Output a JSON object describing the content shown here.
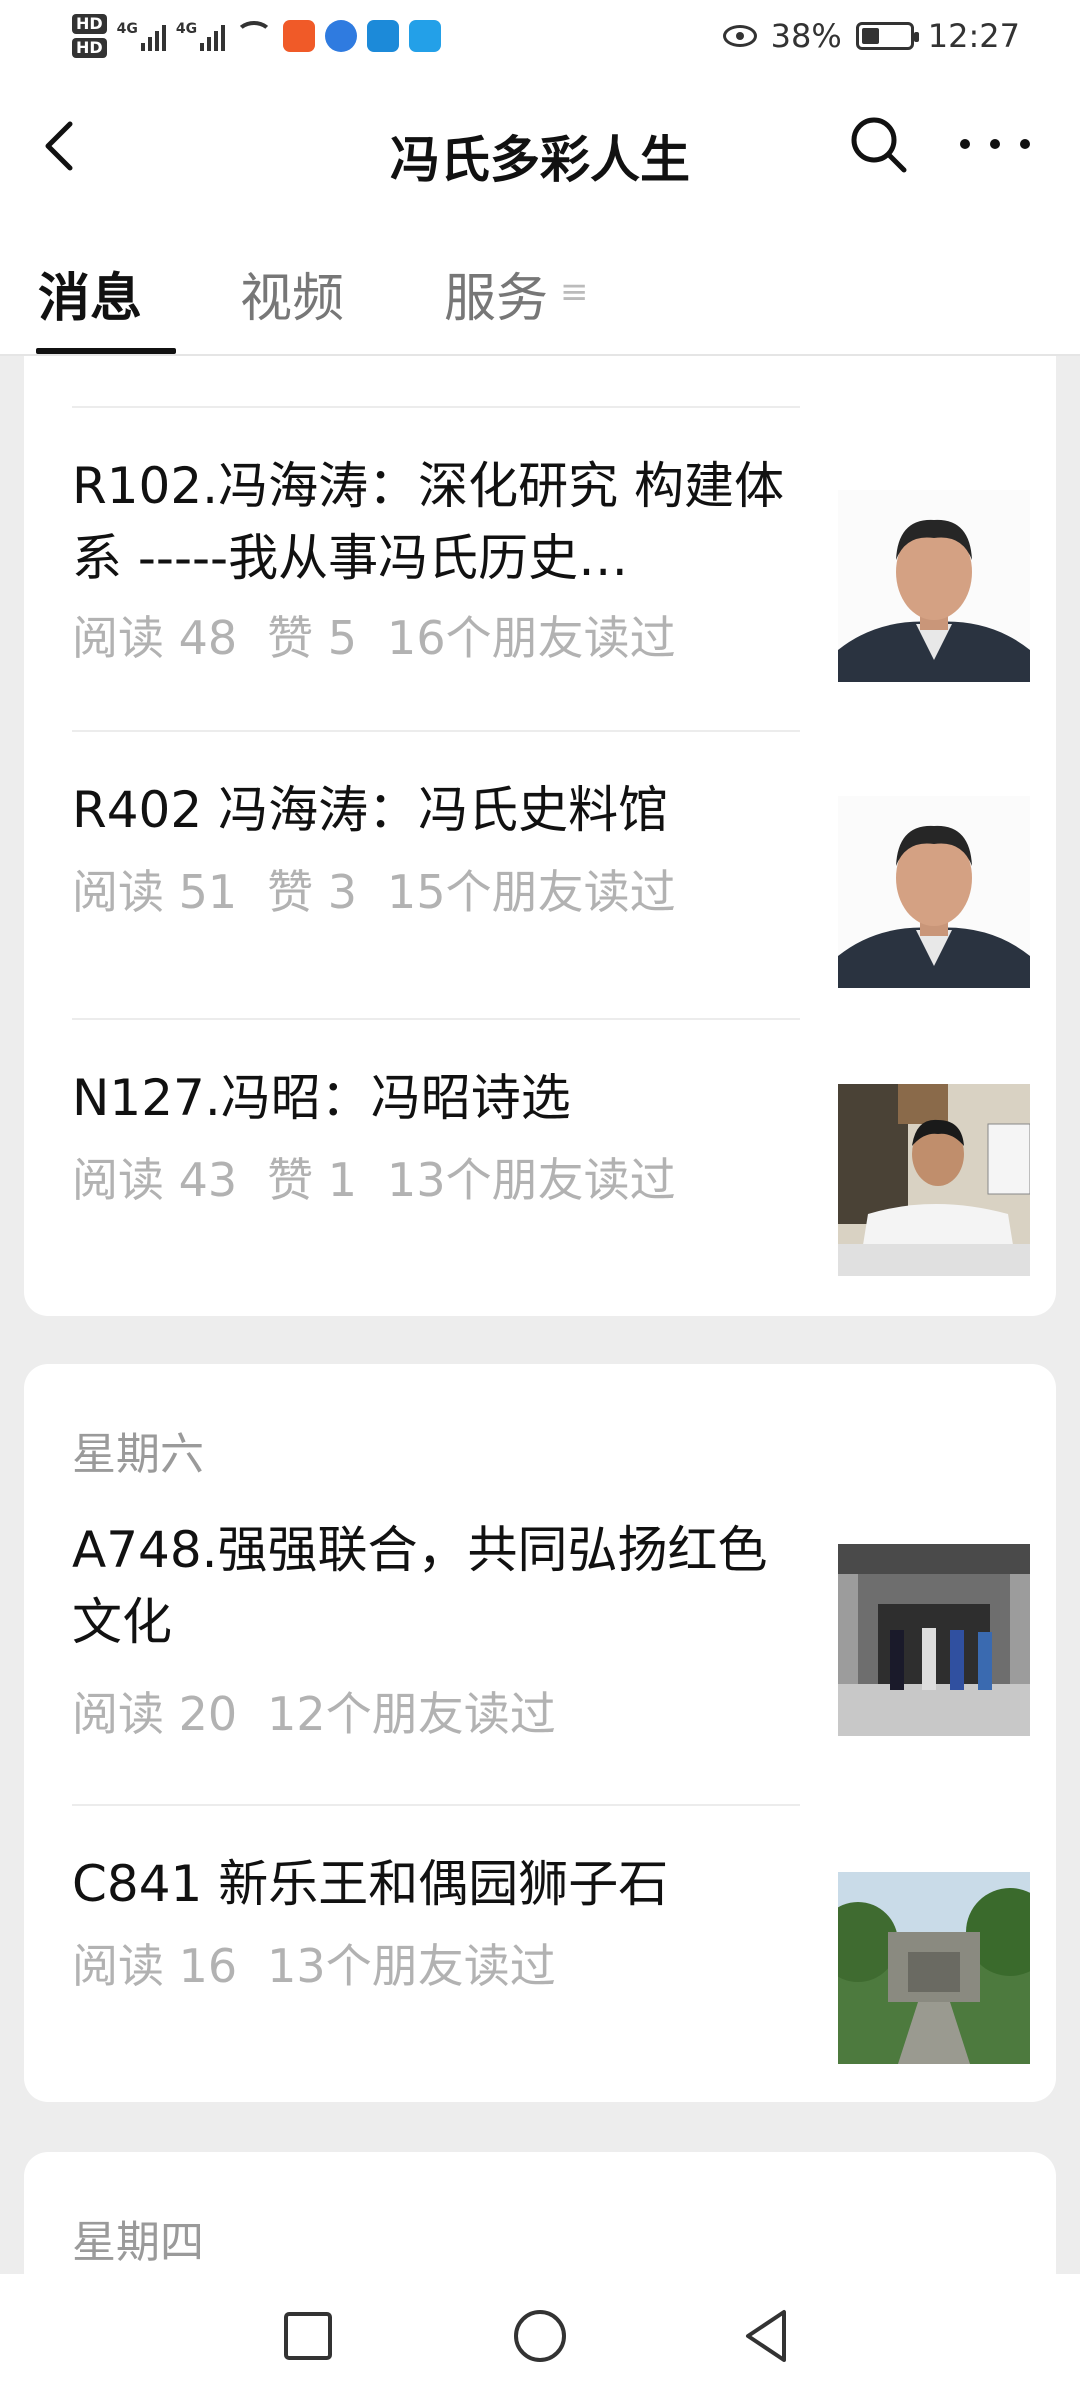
{
  "status_bar": {
    "hd1": "HD",
    "hd2": "HD",
    "net1": "4G",
    "net2": "4G",
    "battery_percent": "38%",
    "battery_level": 0.38,
    "time": "12:27"
  },
  "navbar": {
    "title": "冯氏多彩人生"
  },
  "tabs": {
    "items": [
      {
        "label": "消息"
      },
      {
        "label": "视频"
      },
      {
        "label": "服务"
      }
    ],
    "menu_glyph": "≡"
  },
  "articles": [
    {
      "title": "R102.冯海涛：深化研究 构建体系 -----我从事冯氏历史…",
      "reads": "阅读 48",
      "likes": "赞 5",
      "friends": "16个朋友读过"
    },
    {
      "title": "R402 冯海涛：冯氏史料馆",
      "reads": "阅读 51",
      "likes": "赞 3",
      "friends": "15个朋友读过"
    },
    {
      "title": "N127.冯昭：冯昭诗选",
      "reads": "阅读 43",
      "likes": "赞 1",
      "friends": "13个朋友读过"
    }
  ],
  "group_saturday": {
    "day": "星期六",
    "articles": [
      {
        "title": "A748.强强联合，共同弘扬红色文化",
        "reads": "阅读 20",
        "friends": "12个朋友读过"
      },
      {
        "title": "C841 新乐王和偶园狮子石",
        "reads": "阅读 16",
        "friends": "13个朋友读过"
      }
    ]
  },
  "group_thursday": {
    "day": "星期四"
  },
  "colors": {
    "background": "#ededed",
    "card": "#ffffff",
    "meta_text": "#b2b2b2"
  }
}
